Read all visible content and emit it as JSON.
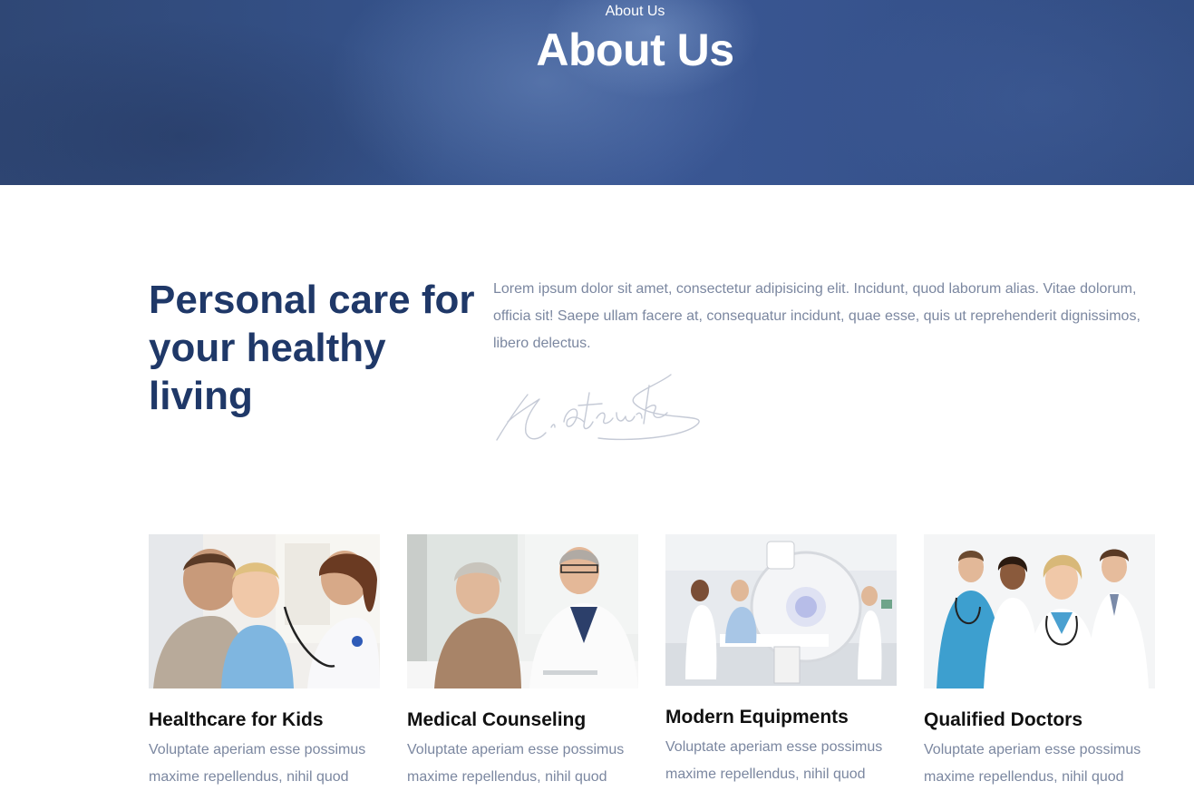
{
  "hero": {
    "breadcrumb": "About Us",
    "title": "About Us"
  },
  "intro": {
    "heading": "Personal care for your healthy living",
    "text": "Lorem ipsum dolor sit amet, consectetur adipisicing elit. Incidunt, quod laborum alias. Vitae dolorum, officia sit! Saepe ullam facere at, consequatur incidunt, quae esse, quis ut reprehenderit dignissimos, libero delectus.",
    "signature_text": "K. Atatürk"
  },
  "features": [
    {
      "title": "Healthcare for Kids",
      "text": "Voluptate aperiam esse possimus maxime repellendus, nihil quod"
    },
    {
      "title": "Medical Counseling",
      "text": "Voluptate aperiam esse possimus maxime repellendus, nihil quod"
    },
    {
      "title": "Modern Equipments",
      "text": "Voluptate aperiam esse possimus maxime repellendus, nihil quod"
    },
    {
      "title": "Qualified Doctors",
      "text": "Voluptate aperiam esse possimus maxime repellendus, nihil quod"
    }
  ],
  "colors": {
    "hero_bg": "#34508a",
    "heading": "#1f3868",
    "body_text": "#7b87a0"
  }
}
